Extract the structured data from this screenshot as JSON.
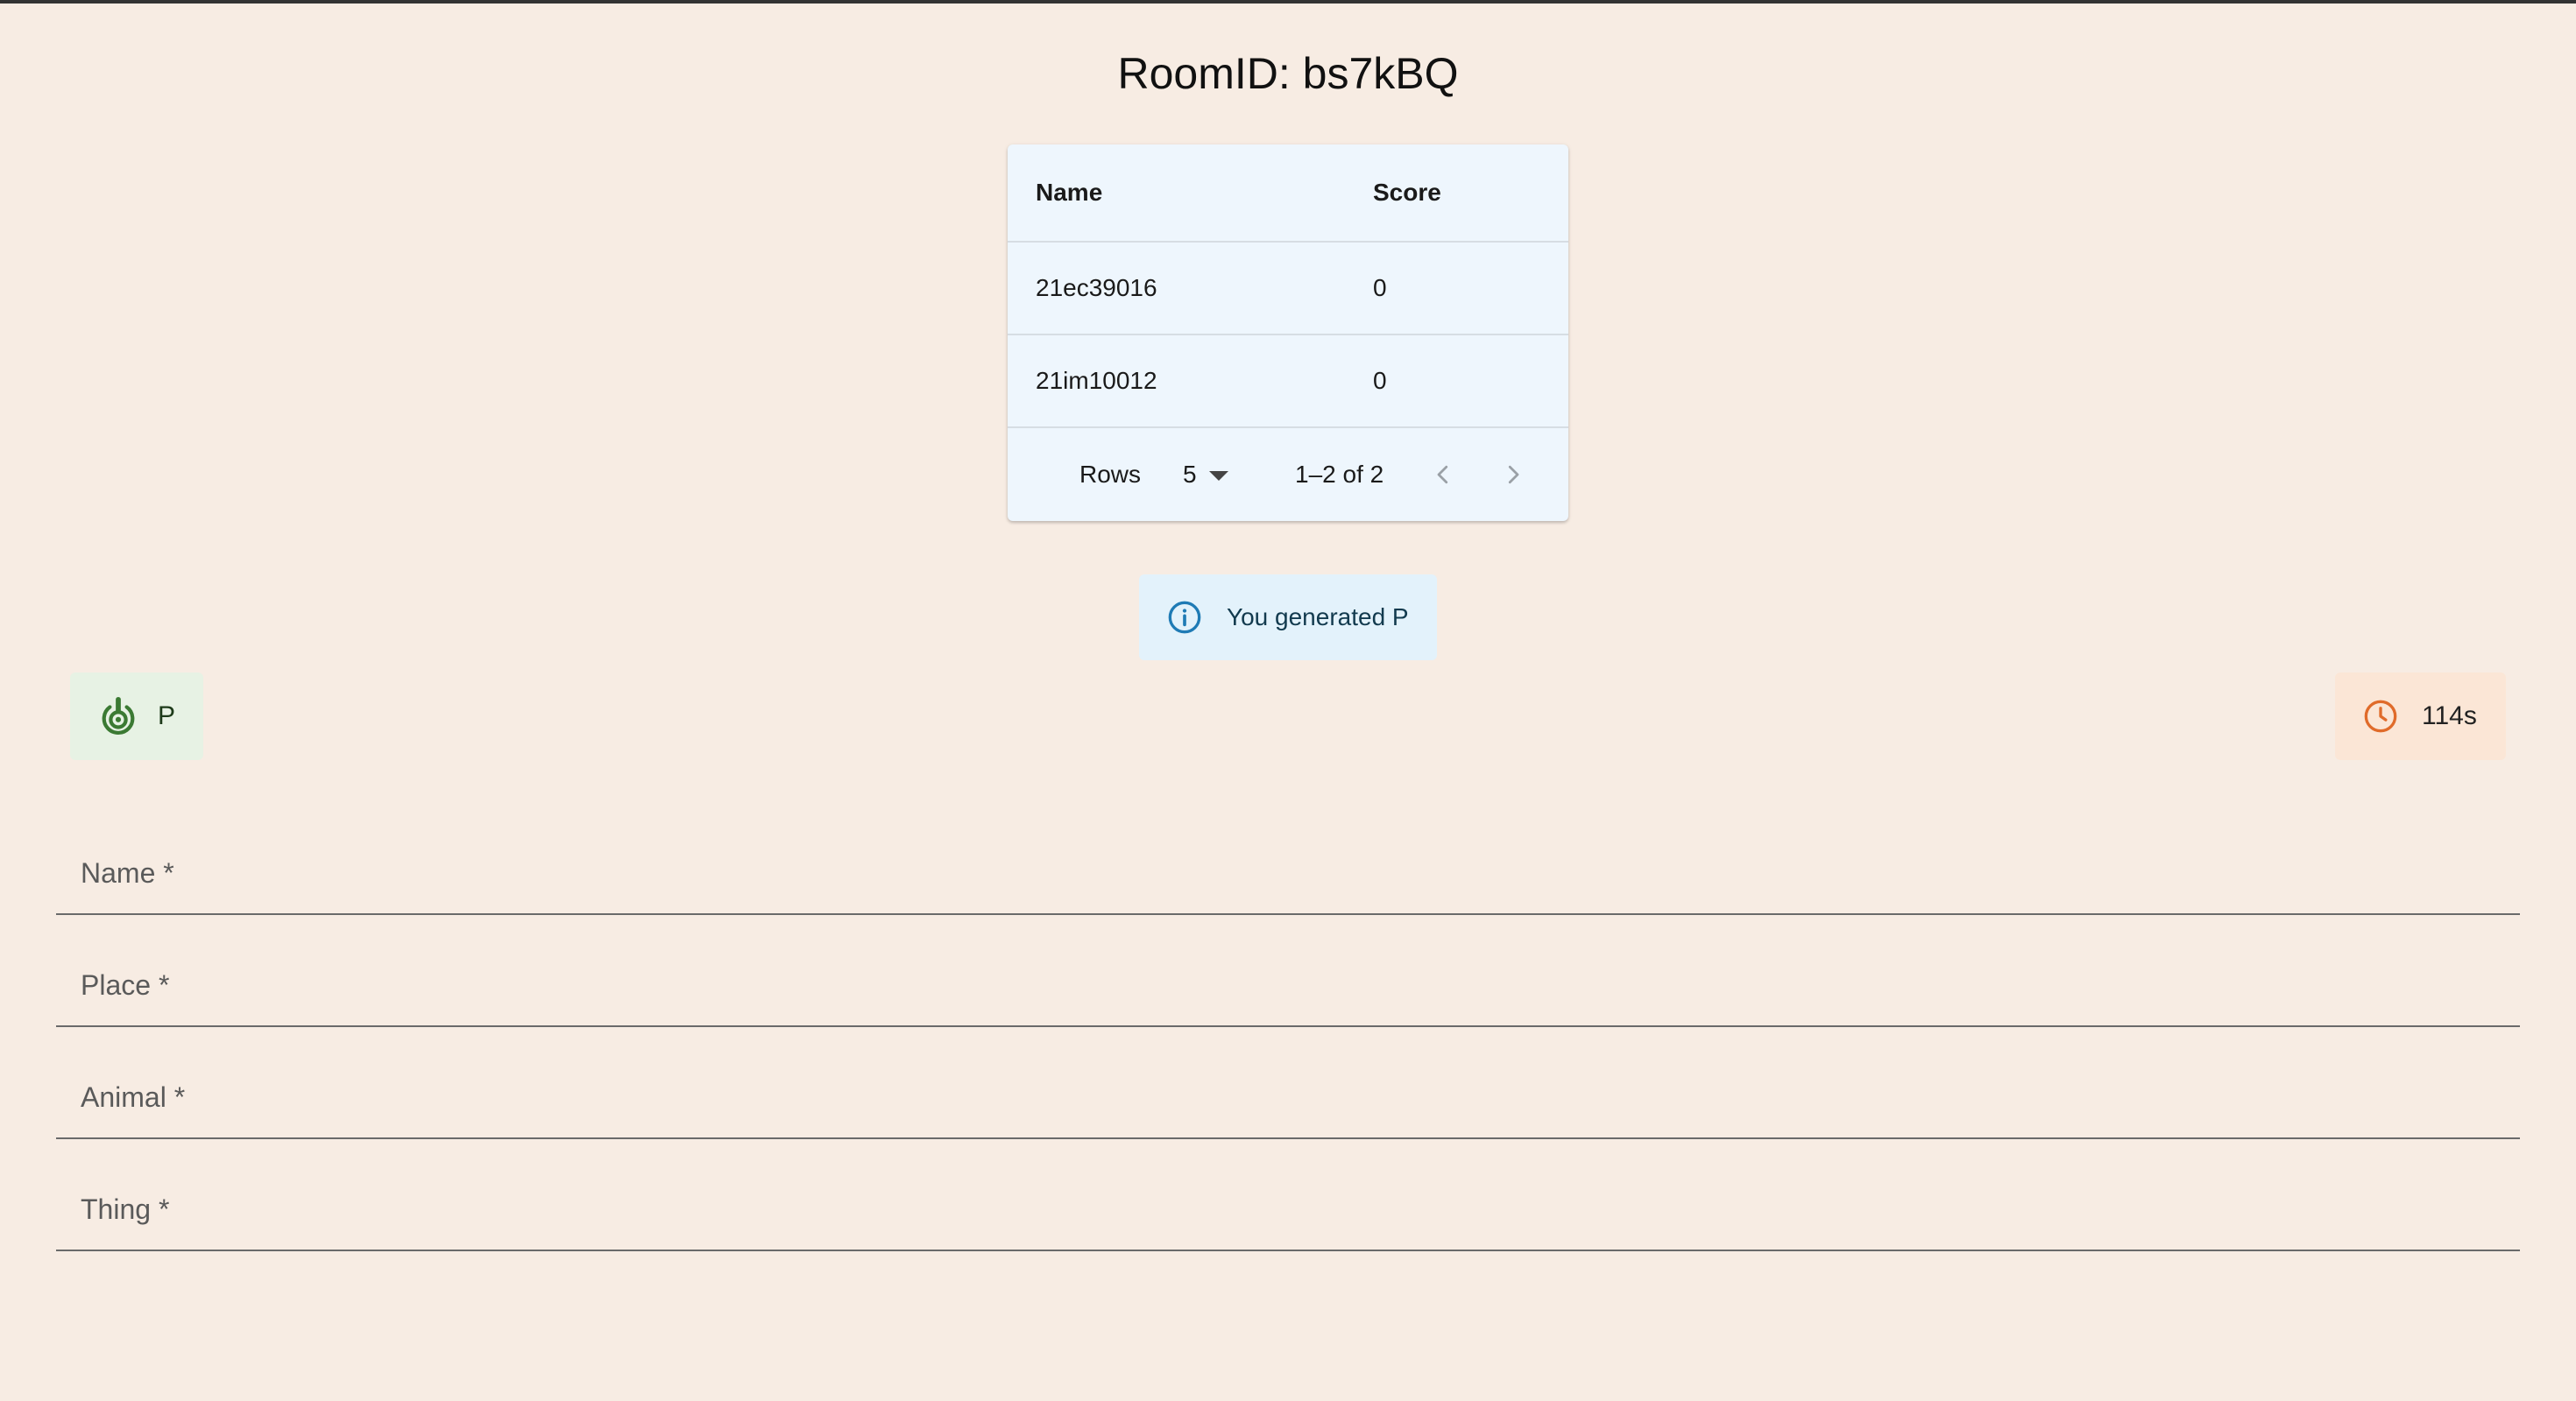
{
  "header": {
    "title": "RoomID: bs7kBQ"
  },
  "scoreboard": {
    "columns": [
      "Name",
      "Score"
    ],
    "rows": [
      {
        "name": "21ec39016",
        "score": "0"
      },
      {
        "name": "21im10012",
        "score": "0"
      }
    ],
    "pagination": {
      "rows_label": "Rows",
      "rows_per_page": "5",
      "range_text": "1–2 of 2",
      "prev_icon": "chevron-left-icon",
      "next_icon": "chevron-right-icon"
    }
  },
  "alert": {
    "icon": "info-icon",
    "text": "You generated P",
    "color": "#1f7bb5"
  },
  "letter_chip": {
    "icon": "target-icon",
    "letter": "P",
    "color": "#3b7a33"
  },
  "timer_chip": {
    "icon": "clock-icon",
    "value": "114s",
    "color": "#e06b2a"
  },
  "form": {
    "fields": [
      {
        "label": "Name *",
        "value": ""
      },
      {
        "label": "Place *",
        "value": ""
      },
      {
        "label": "Animal *",
        "value": ""
      },
      {
        "label": "Thing *",
        "value": ""
      }
    ]
  }
}
